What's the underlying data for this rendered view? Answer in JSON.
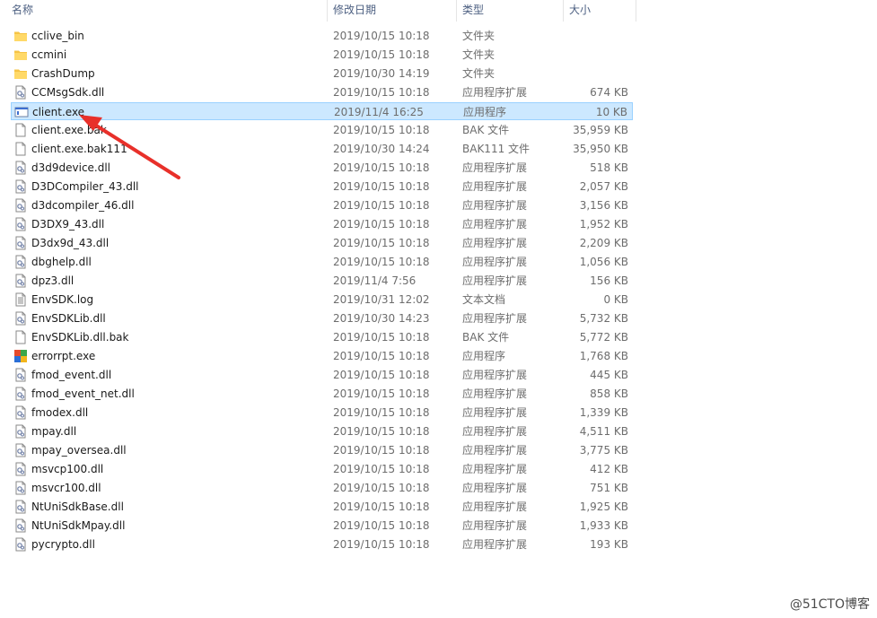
{
  "columns": {
    "name": "名称",
    "date": "修改日期",
    "type": "类型",
    "size": "大小"
  },
  "accent_color": "#e8302a",
  "selected_color": "#cce8ff",
  "files": [
    {
      "name": "cclive_bin",
      "date": "2019/10/15 10:18",
      "type": "文件夹",
      "size": "",
      "icon": "folder-icon"
    },
    {
      "name": "ccmini",
      "date": "2019/10/15 10:18",
      "type": "文件夹",
      "size": "",
      "icon": "folder-icon"
    },
    {
      "name": "CrashDump",
      "date": "2019/10/30 14:19",
      "type": "文件夹",
      "size": "",
      "icon": "folder-icon"
    },
    {
      "name": "CCMsgSdk.dll",
      "date": "2019/10/15 10:18",
      "type": "应用程序扩展",
      "size": "674 KB",
      "icon": "dll-file-icon"
    },
    {
      "name": "client.exe",
      "date": "2019/11/4 16:25",
      "type": "应用程序",
      "size": "10 KB",
      "icon": "exe-window-icon",
      "selected": true
    },
    {
      "name": "client.exe.bak",
      "date": "2019/10/15 10:18",
      "type": "BAK 文件",
      "size": "35,959 KB",
      "icon": "blank-file-icon"
    },
    {
      "name": "client.exe.bak111",
      "date": "2019/10/30 14:24",
      "type": "BAK111 文件",
      "size": "35,950 KB",
      "icon": "blank-file-icon"
    },
    {
      "name": "d3d9device.dll",
      "date": "2019/10/15 10:18",
      "type": "应用程序扩展",
      "size": "518 KB",
      "icon": "dll-file-icon"
    },
    {
      "name": "D3DCompiler_43.dll",
      "date": "2019/10/15 10:18",
      "type": "应用程序扩展",
      "size": "2,057 KB",
      "icon": "dll-file-icon"
    },
    {
      "name": "d3dcompiler_46.dll",
      "date": "2019/10/15 10:18",
      "type": "应用程序扩展",
      "size": "3,156 KB",
      "icon": "dll-file-icon"
    },
    {
      "name": "D3DX9_43.dll",
      "date": "2019/10/15 10:18",
      "type": "应用程序扩展",
      "size": "1,952 KB",
      "icon": "dll-file-icon"
    },
    {
      "name": "D3dx9d_43.dll",
      "date": "2019/10/15 10:18",
      "type": "应用程序扩展",
      "size": "2,209 KB",
      "icon": "dll-file-icon"
    },
    {
      "name": "dbghelp.dll",
      "date": "2019/10/15 10:18",
      "type": "应用程序扩展",
      "size": "1,056 KB",
      "icon": "dll-file-icon"
    },
    {
      "name": "dpz3.dll",
      "date": "2019/11/4 7:56",
      "type": "应用程序扩展",
      "size": "156 KB",
      "icon": "dll-file-icon"
    },
    {
      "name": "EnvSDK.log",
      "date": "2019/10/31 12:02",
      "type": "文本文档",
      "size": "0 KB",
      "icon": "text-file-icon"
    },
    {
      "name": "EnvSDKLib.dll",
      "date": "2019/10/30 14:23",
      "type": "应用程序扩展",
      "size": "5,732 KB",
      "icon": "dll-file-icon"
    },
    {
      "name": "EnvSDKLib.dll.bak",
      "date": "2019/10/15 10:18",
      "type": "BAK 文件",
      "size": "5,772 KB",
      "icon": "blank-file-icon"
    },
    {
      "name": "errorrpt.exe",
      "date": "2019/10/15 10:18",
      "type": "应用程序",
      "size": "1,768 KB",
      "icon": "errorrpt-app-icon"
    },
    {
      "name": "fmod_event.dll",
      "date": "2019/10/15 10:18",
      "type": "应用程序扩展",
      "size": "445 KB",
      "icon": "dll-file-icon"
    },
    {
      "name": "fmod_event_net.dll",
      "date": "2019/10/15 10:18",
      "type": "应用程序扩展",
      "size": "858 KB",
      "icon": "dll-file-icon"
    },
    {
      "name": "fmodex.dll",
      "date": "2019/10/15 10:18",
      "type": "应用程序扩展",
      "size": "1,339 KB",
      "icon": "dll-file-icon"
    },
    {
      "name": "mpay.dll",
      "date": "2019/10/15 10:18",
      "type": "应用程序扩展",
      "size": "4,511 KB",
      "icon": "dll-file-icon"
    },
    {
      "name": "mpay_oversea.dll",
      "date": "2019/10/15 10:18",
      "type": "应用程序扩展",
      "size": "3,775 KB",
      "icon": "dll-file-icon"
    },
    {
      "name": "msvcp100.dll",
      "date": "2019/10/15 10:18",
      "type": "应用程序扩展",
      "size": "412 KB",
      "icon": "dll-file-icon"
    },
    {
      "name": "msvcr100.dll",
      "date": "2019/10/15 10:18",
      "type": "应用程序扩展",
      "size": "751 KB",
      "icon": "dll-file-icon"
    },
    {
      "name": "NtUniSdkBase.dll",
      "date": "2019/10/15 10:18",
      "type": "应用程序扩展",
      "size": "1,925 KB",
      "icon": "dll-file-icon"
    },
    {
      "name": "NtUniSdkMpay.dll",
      "date": "2019/10/15 10:18",
      "type": "应用程序扩展",
      "size": "1,933 KB",
      "icon": "dll-file-icon"
    },
    {
      "name": "pycrypto.dll",
      "date": "2019/10/15 10:18",
      "type": "应用程序扩展",
      "size": "193 KB",
      "icon": "dll-file-icon"
    }
  ],
  "watermark": "@51CTO博客"
}
